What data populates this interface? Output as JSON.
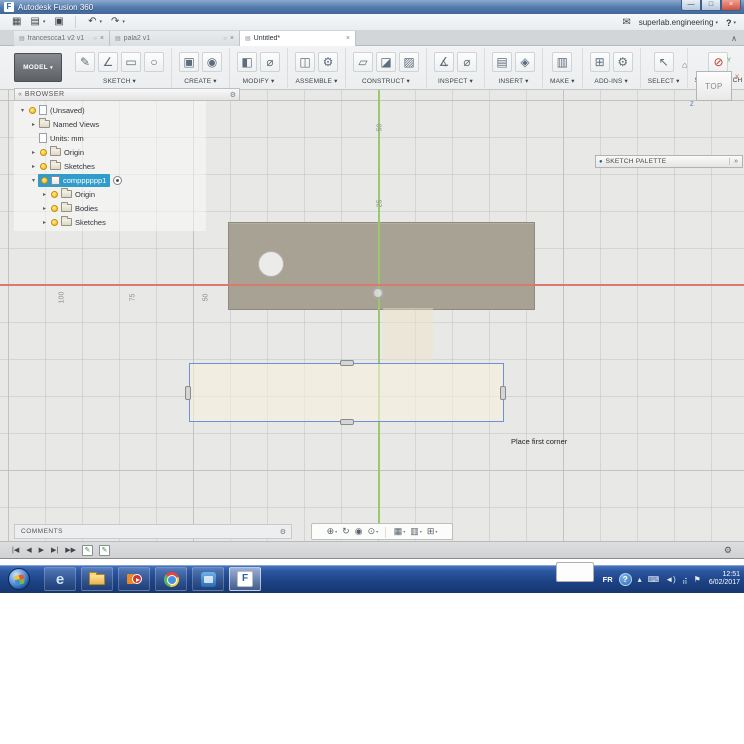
{
  "window": {
    "app_icon": "F",
    "title": "Autodesk Fusion 360",
    "controls": [
      {
        "name": "minimize",
        "glyph": "—"
      },
      {
        "name": "maximize",
        "glyph": "□"
      },
      {
        "name": "close",
        "glyph": "×"
      }
    ]
  },
  "qat": {
    "account": "superlab.engineering"
  },
  "tabs": [
    {
      "label": "francescca1 v2 v1",
      "active": false
    },
    {
      "label": "pala2 v1",
      "active": false
    },
    {
      "label": "Untitled*",
      "active": true
    }
  ],
  "ribbon": {
    "workspace": "MODEL",
    "groups": [
      {
        "label": "SKETCH",
        "caret": true,
        "icons": [
          "✎",
          "∠",
          "▭",
          "○"
        ]
      },
      {
        "label": "CREATE",
        "caret": true,
        "icons": [
          "▣",
          "◉"
        ]
      },
      {
        "label": "MODIFY",
        "caret": true,
        "icons": [
          "◧",
          "⌀"
        ]
      },
      {
        "label": "ASSEMBLE",
        "caret": true,
        "icons": [
          "◫",
          "⚙"
        ]
      },
      {
        "label": "CONSTRUCT",
        "caret": true,
        "icons": [
          "▱",
          "◪",
          "▨"
        ]
      },
      {
        "label": "INSPECT",
        "caret": true,
        "icons": [
          "∡",
          "⌀"
        ]
      },
      {
        "label": "INSERT",
        "caret": true,
        "icons": [
          "▤",
          "◈"
        ]
      },
      {
        "label": "MAKE",
        "caret": true,
        "icons": [
          "▥"
        ]
      },
      {
        "label": "ADD-INS",
        "caret": true,
        "icons": [
          "⊞",
          "⚙"
        ]
      },
      {
        "label": "SELECT",
        "caret": true,
        "icons": [
          "↖"
        ]
      },
      {
        "label": "STOP SKETCH",
        "caret": false,
        "accent": true,
        "icons": [
          "⊘"
        ]
      }
    ]
  },
  "browser": {
    "title": "BROWSER",
    "items": [
      {
        "label": "(Unsaved)",
        "level": 0,
        "expand": "open",
        "bulb": true,
        "icon": "document"
      },
      {
        "label": "Named Views",
        "level": 1,
        "expand": "closed",
        "bulb": false,
        "icon": "folder"
      },
      {
        "label": "Units: mm",
        "level": 1,
        "expand": "none",
        "bulb": false,
        "icon": "document"
      },
      {
        "label": "Origin",
        "level": 1,
        "expand": "closed",
        "bulb": true,
        "icon": "folder"
      },
      {
        "label": "Sketches",
        "level": 1,
        "expand": "closed",
        "bulb": true,
        "icon": "folder"
      },
      {
        "label": "compppppp1",
        "level": 1,
        "expand": "open",
        "bulb": true,
        "icon": "component",
        "selected": true,
        "radio": true
      },
      {
        "label": "Origin",
        "level": 2,
        "expand": "closed",
        "bulb": true,
        "icon": "folder"
      },
      {
        "label": "Bodies",
        "level": 2,
        "expand": "closed",
        "bulb": true,
        "icon": "folder"
      },
      {
        "label": "Sketches",
        "level": 2,
        "expand": "closed",
        "bulb": true,
        "icon": "folder"
      }
    ]
  },
  "viewcube": {
    "face": "TOP",
    "axis_x": "X",
    "axis_y": "Y",
    "axis_z": "Z"
  },
  "sketch_palette": {
    "title": "SKETCH PALETTE"
  },
  "canvas": {
    "vertical_ruler": [
      "50",
      "25"
    ],
    "horizontal_ruler": [
      "100",
      "75",
      "50"
    ],
    "tooltip": "Place first corner",
    "colors": {
      "body": "#a7a294",
      "axis_x": "#d97b6c",
      "axis_y": "#9bc86a",
      "sketch_border": "#6f8fd8",
      "selection_highlight": "#2f9ccc"
    }
  },
  "comments": {
    "title": "COMMENTS"
  },
  "timeline": {
    "controls": [
      "|◀",
      "◀",
      "▶",
      "▶|",
      "▶▶"
    ]
  },
  "taskbar": {
    "language": "FR",
    "time": "12:51",
    "date": "6/02/2017"
  },
  "icons": {
    "app_menu": "▦",
    "file_new": "▤",
    "save": "▣",
    "undo": "↶",
    "redo": "↷",
    "caret": "▾",
    "separator": "│",
    "notification": "✉",
    "help": "?",
    "ribbon_collapse": "∧",
    "tab_doc": "▤",
    "tab_sync": "○",
    "tab_close": "×",
    "panel_collapse": "«",
    "panel_expand": "»",
    "gear": "⚙",
    "home": "⌂",
    "info_dot": "●",
    "expander_open": "▾",
    "expander_closed": "▸",
    "pan": "⊕",
    "orbit": "↻",
    "look_at": "◉",
    "zoom": "⊙",
    "display_settings": "▦",
    "grid_settings": "▥",
    "viewports": "⊞",
    "sketch_feature": "✎",
    "tray_arrow": "▴",
    "tray_keyboard": "⌨",
    "tray_speaker": "◄)",
    "tray_network": "⣴",
    "tray_flag": "⚑"
  }
}
